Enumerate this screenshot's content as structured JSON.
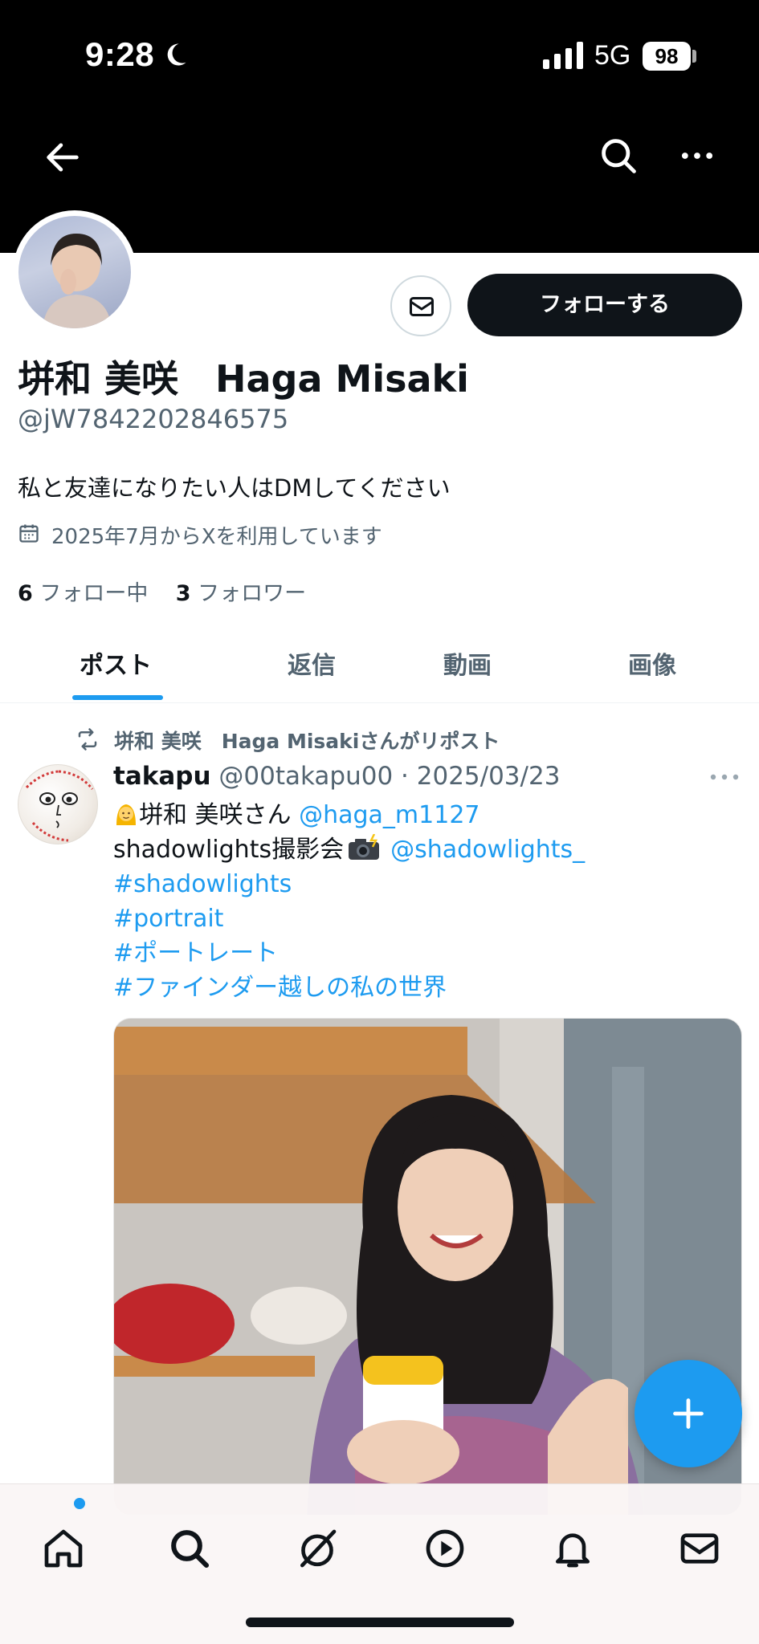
{
  "status_bar": {
    "time": "9:28",
    "network": "5G",
    "battery": "98"
  },
  "profile": {
    "display_name": "垪和 美咲　Haga Misaki",
    "handle": "@jW7842202846575",
    "bio": "私と友達になりたい人はDMしてください",
    "joined": "2025年7月からXを利用しています",
    "following_count": "6",
    "following_label": "フォロー中",
    "followers_count": "3",
    "followers_label": "フォロワー",
    "follow_button": "フォローする"
  },
  "tabs": [
    {
      "label": "ポスト",
      "active": true
    },
    {
      "label": "返信",
      "active": false
    },
    {
      "label": "動画",
      "active": false
    },
    {
      "label": "画像",
      "active": false
    }
  ],
  "post": {
    "repost_label": "垪和 美咲　Haga Misakiさんがリポスト",
    "author_name": "takapu",
    "author_handle": "@00takapu00",
    "date": "2025/03/23",
    "line1_text": "垪和 美咲さん",
    "line1_mention": "@haga_m1127",
    "line2_text": "shadowlights撮影会",
    "line2_mention": "@shadowlights_",
    "hashtags": [
      "#shadowlights",
      "#portrait",
      "#ポートレート",
      "#ファインダー越しの私の世界"
    ]
  },
  "colors": {
    "accent": "#1d9bf0",
    "text": "#0f1419",
    "muted": "#536471",
    "banner": "#000000"
  },
  "icons": {
    "nav": [
      "back-arrow-icon",
      "search-icon",
      "more-icon"
    ],
    "bottom": [
      "home-icon",
      "search-icon",
      "grok-icon",
      "video-icon",
      "notifications-icon",
      "messages-icon"
    ]
  }
}
